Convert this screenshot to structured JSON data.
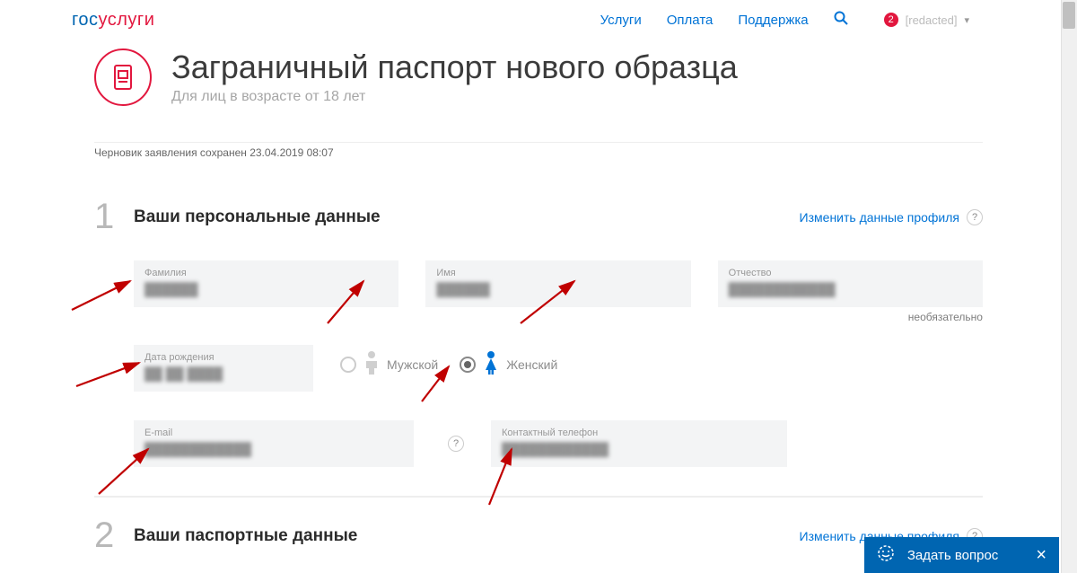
{
  "header": {
    "logo_prefix": "гос",
    "logo_suffix": "услуги",
    "nav": {
      "services": "Услуги",
      "payment": "Оплата",
      "support": "Поддержка"
    },
    "notification_count": "2",
    "username": "[redacted]"
  },
  "page": {
    "title": "Заграничный паспорт нового образца",
    "subtitle": "Для лиц в возрасте от 18 лет",
    "draft_note": "Черновик заявления сохранен 23.04.2019 08:07"
  },
  "section1": {
    "num": "1",
    "title": "Ваши персональные данные",
    "edit_link": "Изменить данные профиля",
    "fields": {
      "lastname_label": "Фамилия",
      "lastname_value": "██████",
      "firstname_label": "Имя",
      "firstname_value": "██████",
      "middlename_label": "Отчество",
      "middlename_value": "████████████",
      "middlename_optional": "необязательно",
      "dob_label": "Дата рождения",
      "dob_value": "██ ██ ████",
      "gender_male": "Мужской",
      "gender_female": "Женский",
      "gender_selected": "female",
      "email_label": "E-mail",
      "email_value": "████████████",
      "phone_label": "Контактный телефон",
      "phone_value": "████████████"
    }
  },
  "section2": {
    "num": "2",
    "title": "Ваши паспортные данные",
    "edit_link": "Изменить данные профиля"
  },
  "chat": {
    "label": "Задать вопрос"
  }
}
